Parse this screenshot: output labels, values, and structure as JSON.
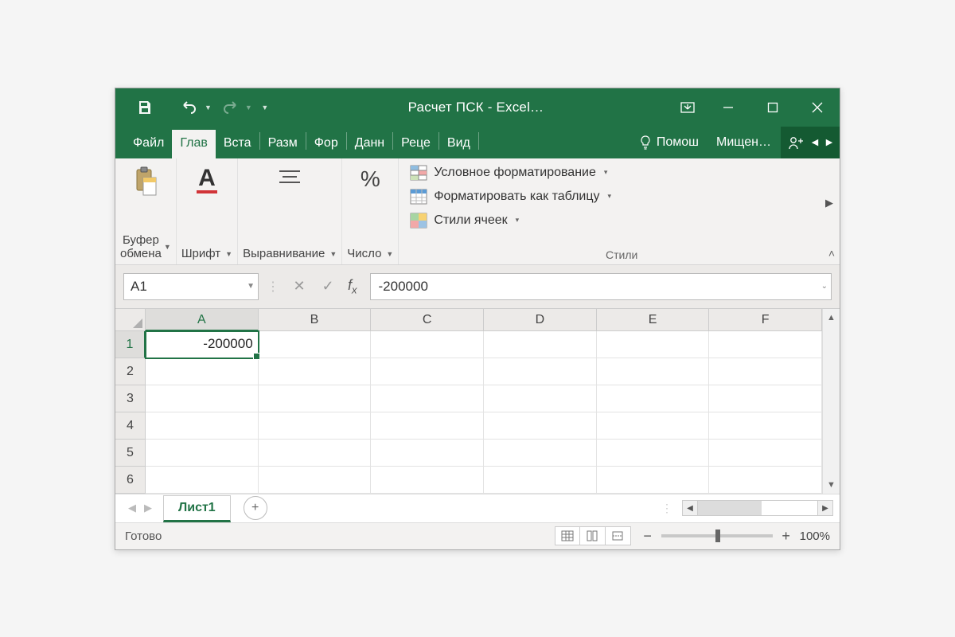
{
  "titlebar": {
    "title": "Расчет ПСК - Excel…"
  },
  "tabs": {
    "file": "Файл",
    "home": "Глав",
    "insert": "Вста",
    "layout": "Разм",
    "formulas": "Фор",
    "data": "Данн",
    "review": "Реце",
    "view": "Вид",
    "tell_me": "Помош",
    "account": "Мищен…"
  },
  "ribbon": {
    "clipboard_label": "Буфер\nобмена",
    "font_label": "Шрифт",
    "alignment_label": "Выравнивание",
    "number_label": "Число",
    "number_icon": "%",
    "styles": {
      "cond_format": "Условное форматирование",
      "format_table": "Форматировать как таблицу",
      "cell_styles": "Стили ячеек",
      "group_name": "Стили"
    }
  },
  "formula_bar": {
    "name_box": "A1",
    "formula": "-200000"
  },
  "grid": {
    "columns": [
      "A",
      "B",
      "C",
      "D",
      "E",
      "F"
    ],
    "rows": [
      "1",
      "2",
      "3",
      "4",
      "5",
      "6"
    ],
    "selected_cell": "A1",
    "cells": {
      "A1": "-200000"
    }
  },
  "sheet": {
    "active": "Лист1"
  },
  "status": {
    "ready": "Готово",
    "zoom": "100%"
  }
}
